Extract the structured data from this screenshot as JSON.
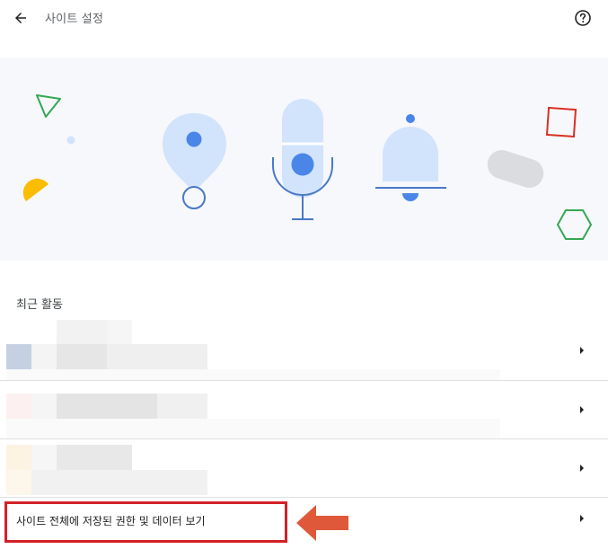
{
  "header": {
    "title": "사이트 설정",
    "back_icon": "arrow-back-icon",
    "help_icon": "help-circle-icon"
  },
  "hero": {
    "icons": [
      "location-pin-icon",
      "microphone-icon",
      "notification-bell-icon"
    ],
    "colors": {
      "background": "#f6f8fb",
      "icon_fill": "#d2e3fc",
      "icon_accent": "#4a86e8",
      "icon_stroke": "#4a79c7",
      "triangle": "#34a853",
      "square": "#d93025",
      "hexagon": "#34a853",
      "half_circle": "#fbbc04",
      "pill": "#dadce0"
    }
  },
  "recent_activity": {
    "title": "최근 활동",
    "rows": [
      {
        "name": "recent-site-1",
        "redacted": true
      },
      {
        "name": "recent-site-2",
        "redacted": true
      },
      {
        "name": "recent-site-3",
        "redacted": true
      }
    ]
  },
  "view_all": {
    "label": "사이트 전체에 저장된 권한 및 데이터 보기"
  },
  "annotation": {
    "box_color": "#d32027",
    "arrow_color": "#e0583a"
  }
}
